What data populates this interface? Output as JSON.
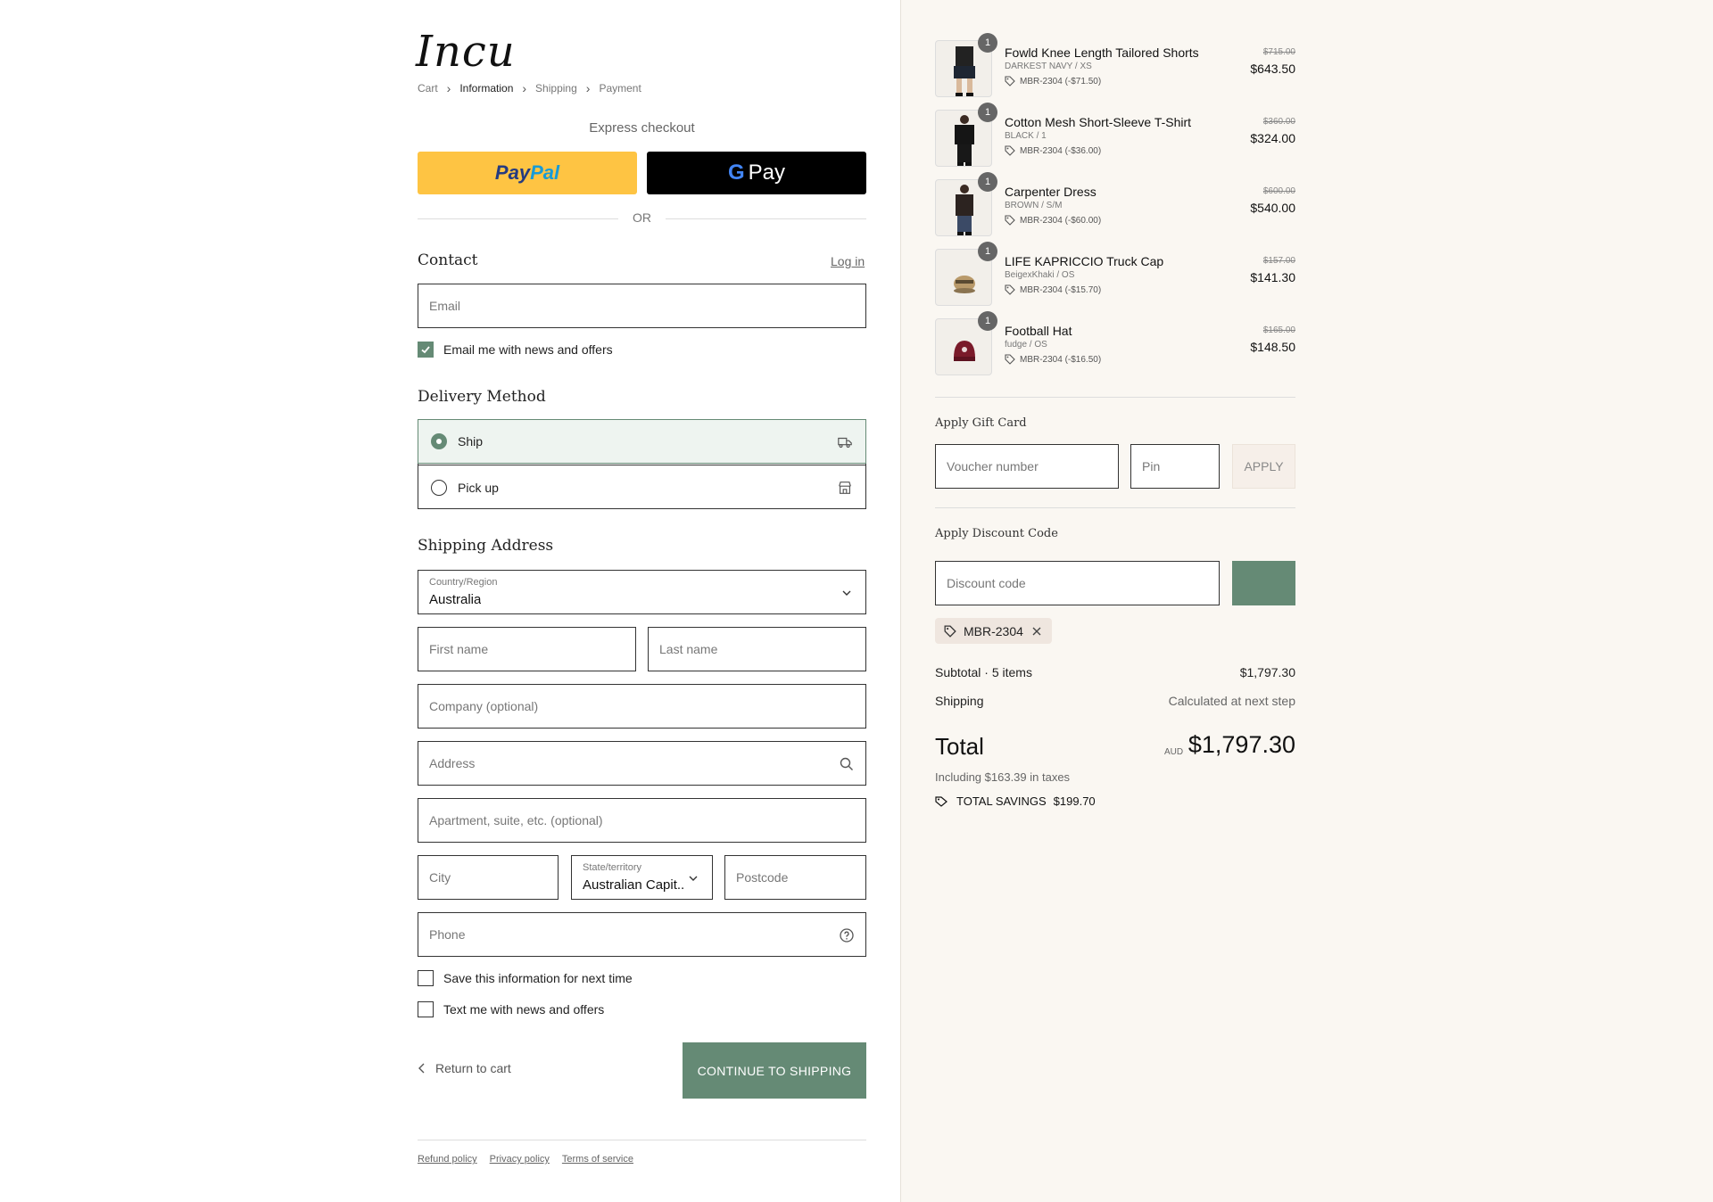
{
  "brand": {
    "logo": "Incu"
  },
  "breadcrumb": [
    "Cart",
    "Information",
    "Shipping",
    "Payment"
  ],
  "express": {
    "title": "Express checkout",
    "paypal_a": "Pay",
    "paypal_b": "Pal",
    "gpay_g": "G",
    "gpay_pay": "Pay"
  },
  "or_label": "OR",
  "contact": {
    "title": "Contact",
    "login": "Log in",
    "email_placeholder": "Email",
    "news_label": "Email me with news and offers",
    "news_checked": true
  },
  "delivery": {
    "title": "Delivery Method",
    "options": [
      {
        "label": "Ship",
        "selected": true
      },
      {
        "label": "Pick up",
        "selected": false
      }
    ]
  },
  "shipping": {
    "title": "Shipping Address",
    "country_label": "Country/Region",
    "country_value": "Australia",
    "first_name": "First name",
    "last_name": "Last name",
    "company": "Company (optional)",
    "address": "Address",
    "apartment": "Apartment, suite, etc. (optional)",
    "city": "City",
    "state_label": "State/territory",
    "state_value": "Australian Capit...",
    "postcode": "Postcode",
    "phone": "Phone",
    "save_info": "Save this information for next time",
    "text_me": "Text me with news and offers"
  },
  "actions": {
    "return": "Return to cart",
    "continue": "CONTINUE TO SHIPPING"
  },
  "footer": [
    "Refund policy",
    "Privacy policy",
    "Terms of service"
  ],
  "cart": {
    "items": [
      {
        "qty": "1",
        "name": "Fowld Knee Length Tailored Shorts",
        "variant": "DARKEST NAVY / XS",
        "discount": "MBR-2304 (-$71.50)",
        "old_price": "$715.00",
        "price": "$643.50"
      },
      {
        "qty": "1",
        "name": "Cotton Mesh Short-Sleeve T-Shirt",
        "variant": "BLACK / 1",
        "discount": "MBR-2304 (-$36.00)",
        "old_price": "$360.00",
        "price": "$324.00"
      },
      {
        "qty": "1",
        "name": "Carpenter Dress",
        "variant": "BROWN / S/M",
        "discount": "MBR-2304 (-$60.00)",
        "old_price": "$600.00",
        "price": "$540.00"
      },
      {
        "qty": "1",
        "name": "LIFE KAPRICCIO Truck Cap",
        "variant": "BeigexKhaki / OS",
        "discount": "MBR-2304 (-$15.70)",
        "old_price": "$157.00",
        "price": "$141.30"
      },
      {
        "qty": "1",
        "name": "Football Hat",
        "variant": "fudge / OS",
        "discount": "MBR-2304 (-$16.50)",
        "old_price": "$165.00",
        "price": "$148.50"
      }
    ],
    "gift_card": {
      "title": "Apply Gift Card",
      "voucher": "Voucher number",
      "pin": "Pin",
      "apply": "APPLY"
    },
    "discount": {
      "title": "Apply Discount Code",
      "placeholder": "Discount code",
      "applied_code": "MBR-2304"
    },
    "summary": {
      "subtotal_label": "Subtotal · 5 items",
      "subtotal_value": "$1,797.30",
      "shipping_label": "Shipping",
      "shipping_value": "Calculated at next step",
      "total_label": "Total",
      "currency": "AUD",
      "total_value": "$1,797.30",
      "taxes": "Including $163.39 in taxes",
      "savings_label": "TOTAL SAVINGS",
      "savings_value": "$199.70"
    }
  },
  "colors": {
    "accent": "#658a75",
    "paypal_yellow": "#fec443",
    "panel_bg": "#faf7f2"
  }
}
